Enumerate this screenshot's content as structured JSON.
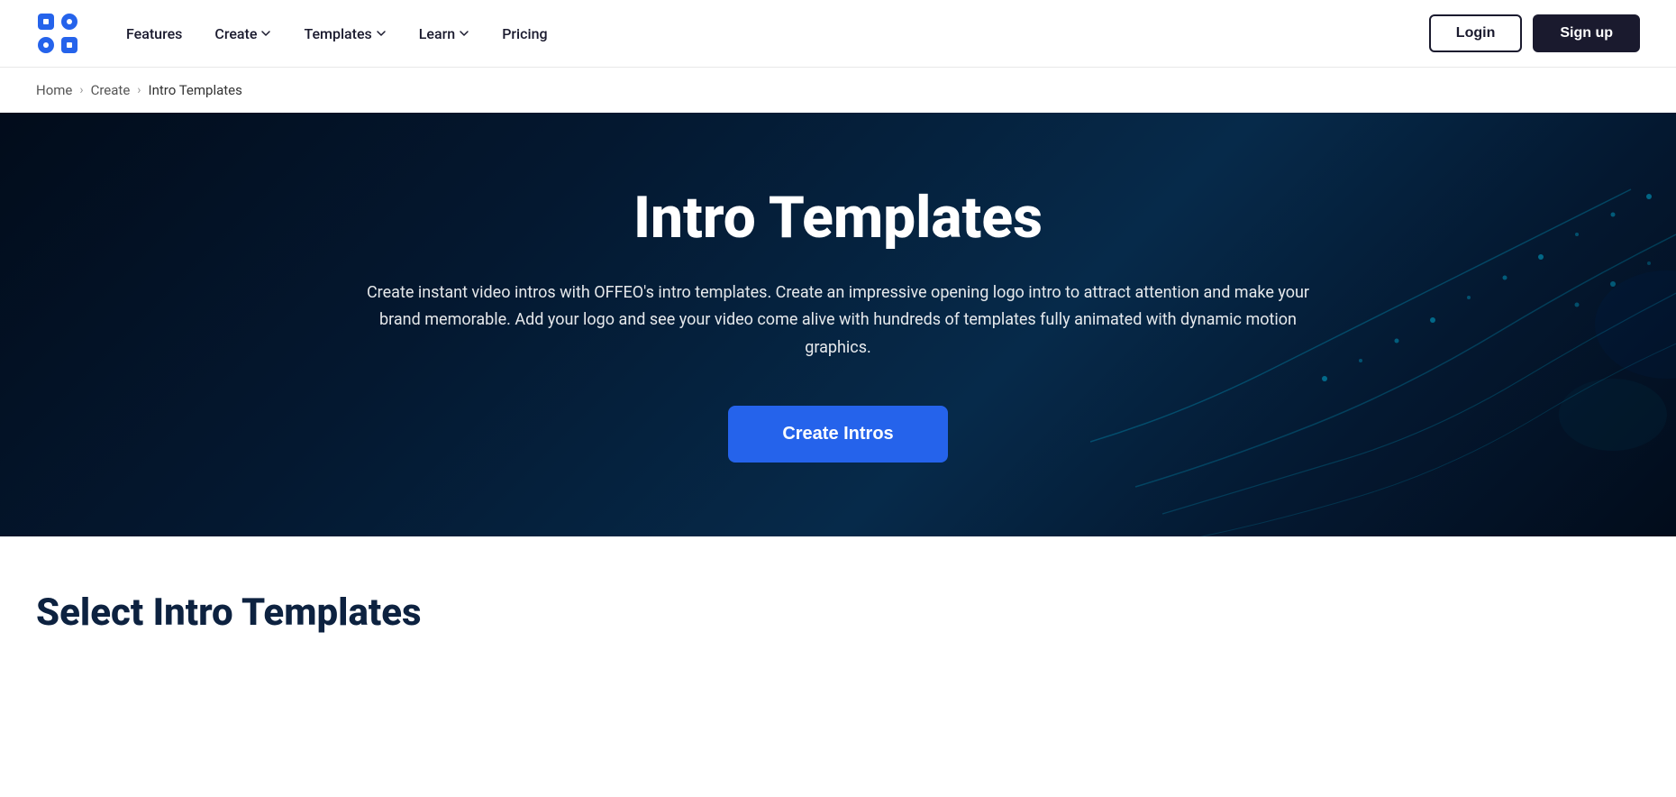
{
  "navbar": {
    "logo_alt": "OFFEO Logo",
    "links": [
      {
        "label": "Features",
        "has_dropdown": false
      },
      {
        "label": "Create",
        "has_dropdown": true
      },
      {
        "label": "Templates",
        "has_dropdown": true
      },
      {
        "label": "Learn",
        "has_dropdown": true
      },
      {
        "label": "Pricing",
        "has_dropdown": false
      }
    ],
    "login_label": "Login",
    "signup_label": "Sign up"
  },
  "breadcrumb": {
    "home": "Home",
    "create": "Create",
    "current": "Intro Templates"
  },
  "hero": {
    "title": "Intro Templates",
    "description": "Create instant video intros with OFFEO's intro templates. Create an impressive opening logo intro to attract attention and make your brand memorable. Add your logo and see your video come alive with hundreds of templates fully animated with dynamic motion graphics.",
    "cta_label": "Create Intros"
  },
  "below": {
    "section_title": "Select Intro Templates"
  }
}
